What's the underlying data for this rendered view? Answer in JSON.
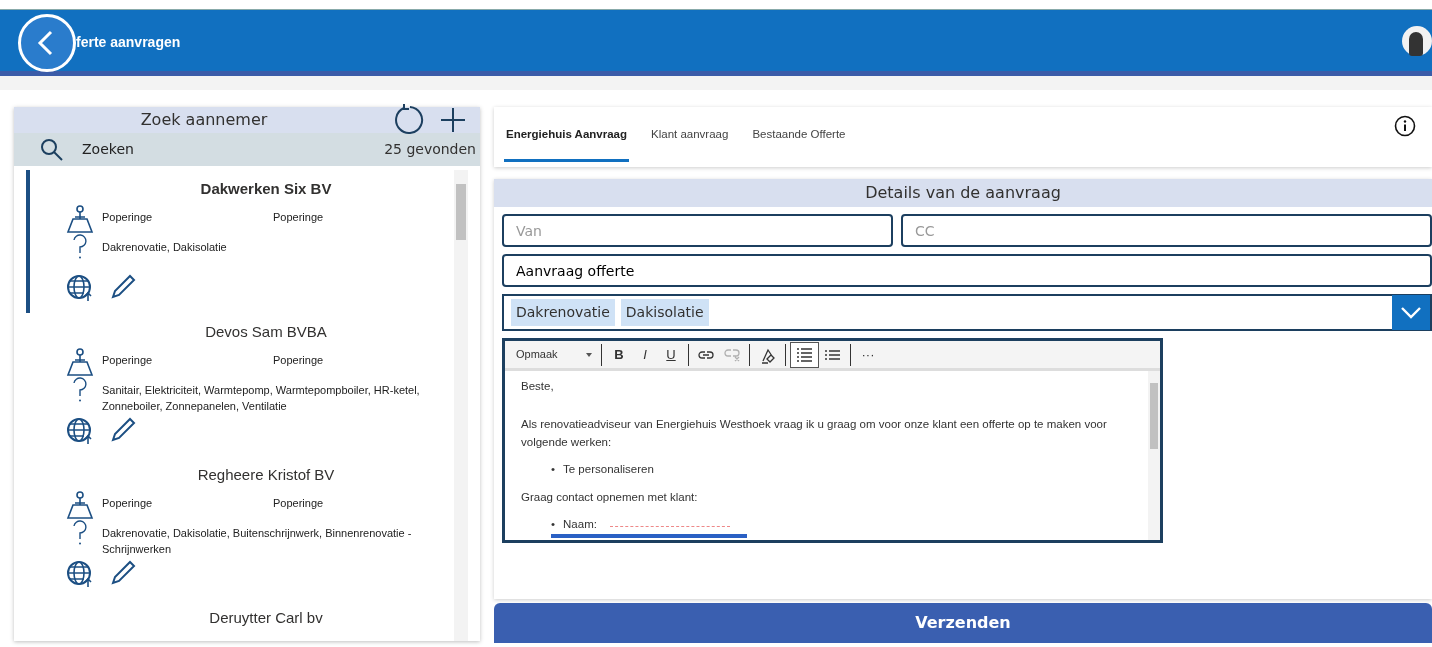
{
  "header": {
    "title": "ferte aanvragen"
  },
  "contractors": {
    "title": "Zoek aannemer",
    "search": {
      "placeholder": "Zoeken"
    },
    "count": "25 gevonden",
    "items": [
      {
        "name": "Dakwerken Six BV",
        "selected": true,
        "city": "Poperinge",
        "city_2": "Poperinge",
        "services": "Dakrenovatie, Dakisolatie"
      },
      {
        "name": "Devos Sam BVBA",
        "selected": false,
        "city": "Poperinge",
        "city_2": "Poperinge",
        "services": "Sanitair, Elektriciteit, Warmtepomp, Warmtepompboiler, HR-ketel, Zonneboiler, Zonnepanelen, Ventilatie"
      },
      {
        "name": "Regheere Kristof BV",
        "selected": false,
        "city": "Poperinge",
        "city_2": "Poperinge",
        "services": "Dakrenovatie, Dakisolatie, Buitenschrijnwerk, Binnenrenovatie - Schrijnwerken"
      },
      {
        "name": "Deruytter Carl bv",
        "selected": false
      }
    ]
  },
  "tabs": [
    {
      "label": "Energiehuis Aanvraag",
      "selected": true
    },
    {
      "label": "Klant aanvraag",
      "selected": false
    },
    {
      "label": "Bestaande Offerte",
      "selected": false
    }
  ],
  "details": {
    "title": "Details van de aanvraag",
    "from": {
      "placeholder": "Van"
    },
    "cc": {
      "placeholder": "CC"
    },
    "subject": {
      "value": "Aanvraag offerte"
    },
    "tags": [
      "Dakrenovatie",
      "Dakisolatie"
    ],
    "toolbar": [
      {
        "kind": "dropdown",
        "label": "Opmaak"
      },
      {
        "kind": "text",
        "label": "B"
      },
      {
        "kind": "text",
        "label": "I"
      },
      {
        "kind": "text",
        "label": "U"
      },
      {
        "kind": "icon",
        "disabled": false,
        "active": false
      },
      {
        "kind": "icon",
        "disabled": true,
        "active": false
      },
      {
        "kind": "icon",
        "disabled": false,
        "active": false
      },
      {
        "kind": "icon",
        "disabled": false,
        "active": true
      },
      {
        "kind": "icon",
        "disabled": false,
        "active": false
      },
      {
        "kind": "text",
        "label": "···"
      }
    ],
    "body": [
      {
        "kind": "p",
        "text": "Beste,"
      },
      {
        "kind": "p",
        "text": "Als renovatieadviseur van Energiehuis Westhoek vraag ik u graag om voor onze klant een offerte op te maken voor volgende werken:"
      },
      {
        "kind": "ul",
        "items": [
          {
            "marker": "•",
            "text": "Te personaliseren"
          }
        ]
      },
      {
        "kind": "p",
        "text": "Graag contact opnemen met klant:"
      },
      {
        "kind": "ul",
        "items": [
          {
            "marker": "•",
            "text": "Naam:"
          }
        ]
      }
    ]
  },
  "submit": {
    "label": "Verzenden"
  }
}
